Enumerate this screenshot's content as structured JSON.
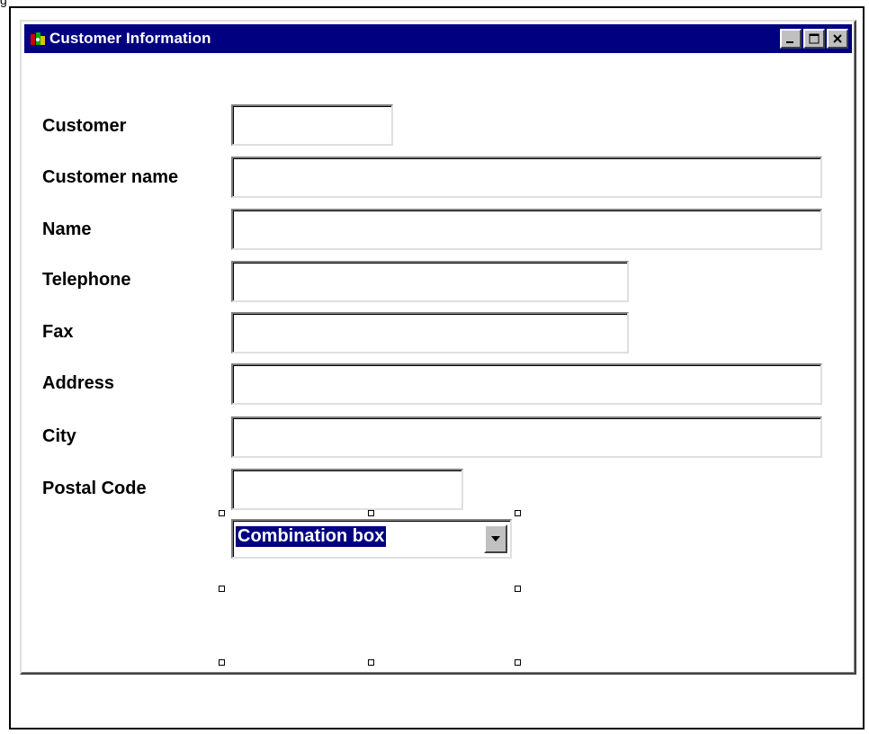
{
  "window": {
    "title": "Customer Information",
    "controls": {
      "minimize": "minimize-icon",
      "maximize": "maximize-icon",
      "close": "close-icon"
    },
    "title_bar_color": "#000080"
  },
  "form": {
    "labels": {
      "customer": "Customer",
      "customer_name": "Customer name",
      "name": "Name",
      "telephone": "Telephone",
      "fax": "Fax",
      "address": "Address",
      "city": "City",
      "postal_code": "Postal Code"
    },
    "values": {
      "customer": "",
      "customer_name": "",
      "name": "",
      "telephone": "",
      "fax": "",
      "address": "",
      "city": "",
      "postal_code": ""
    },
    "combo": {
      "value": "Combination box",
      "arrow_icon": "chevron-down-icon"
    }
  }
}
